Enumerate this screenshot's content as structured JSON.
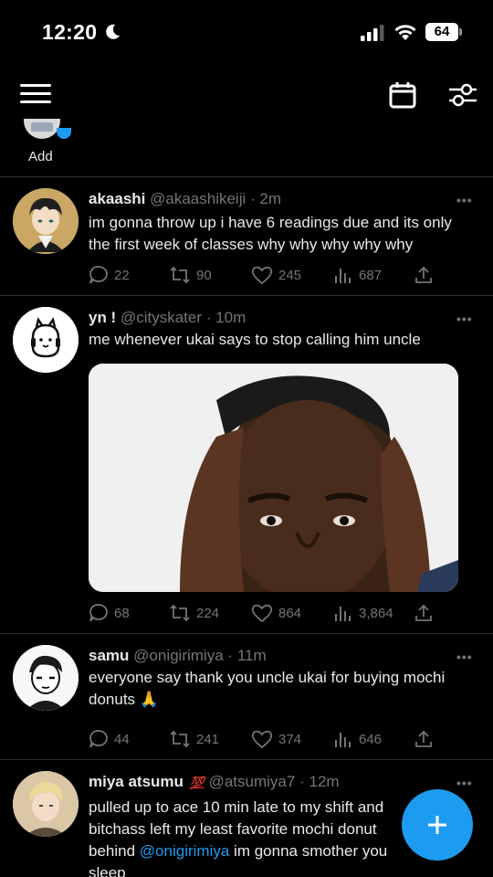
{
  "status_bar": {
    "time": "12:20",
    "battery": "64",
    "icons": [
      "moon-icon",
      "cellular-signal-icon",
      "wifi-icon",
      "battery-icon"
    ]
  },
  "toolbar": {
    "icons": [
      "menu-icon",
      "calendar-icon",
      "filter-sliders-icon"
    ]
  },
  "add_strip": {
    "label": "Add"
  },
  "tweets": [
    {
      "name": "akaashi",
      "handle": "@akaashikeiji",
      "sep": "·",
      "time": "2m",
      "text_lines": [
        "im gonna throw up i have 6 readings due and its only",
        "the first week of classes why why why why why"
      ],
      "replies": "22",
      "retweets": "90",
      "likes": "245",
      "views": "687"
    },
    {
      "name": "yn !",
      "handle": "@cityskater",
      "sep": "·",
      "time": "10m",
      "text_lines": [
        "me whenever ukai says to stop calling him uncle"
      ],
      "replies": "68",
      "retweets": "224",
      "likes": "864",
      "views": "3,864"
    },
    {
      "name": "samu",
      "handle": "@onigirimiya",
      "sep": "·",
      "time": "11m",
      "text_lines": [
        "everyone say thank you uncle ukai for buying mochi",
        "donuts 🙏"
      ],
      "replies": "44",
      "retweets": "241",
      "likes": "374",
      "views": "646"
    },
    {
      "name": "miya atsumu",
      "badge": "💯",
      "handle": "@atsumiya7",
      "sep": "·",
      "time": "12m",
      "text_lines": [
        "pulled up to ace 10 min late to my shift and",
        "bitchass left my least favorite mochi donut",
        "behind",
        "@onigirimiya",
        "im gonna smother you",
        "sleep"
      ]
    }
  ],
  "more_label": "•••",
  "colors": {
    "background": "#000000",
    "divider": "#2f3336",
    "muted": "#71767b",
    "accent": "#1d9bf0"
  }
}
